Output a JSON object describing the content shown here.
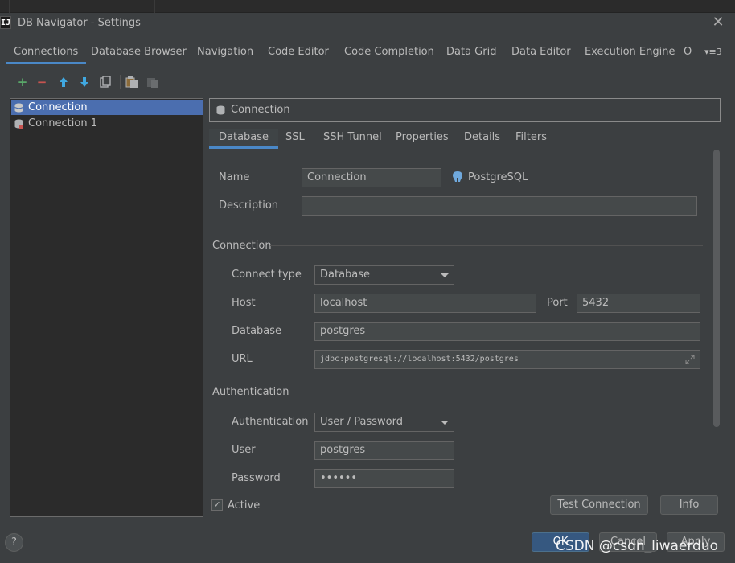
{
  "window": {
    "app_icon_text": "IJ",
    "title": "DB Navigator - Settings",
    "close_glyph": "✕"
  },
  "main_tabs": [
    {
      "label": "Connections",
      "active": true
    },
    {
      "label": "Database Browser",
      "active": false
    },
    {
      "label": "Navigation",
      "active": false
    },
    {
      "label": "Code Editor",
      "active": false
    },
    {
      "label": "Code Completion",
      "active": false
    },
    {
      "label": "Data Grid",
      "active": false
    },
    {
      "label": "Data Editor",
      "active": false
    },
    {
      "label": "Execution Engine",
      "active": false
    },
    {
      "label": "O",
      "active": false
    }
  ],
  "tabs_overflow": "▾≡3",
  "toolbar": {
    "add": "+",
    "remove": "−",
    "up": "🡅",
    "down": "🡇",
    "add_color": "#59a869",
    "remove_color": "#c75450",
    "move_color": "#40a8e0"
  },
  "connections": [
    {
      "label": "Connection",
      "selected": true,
      "icon": "database-icon"
    },
    {
      "label": "Connection 1",
      "selected": false,
      "icon": "database-error-icon"
    }
  ],
  "header": {
    "label": "Connection"
  },
  "sub_tabs": [
    {
      "label": "Database",
      "active": true
    },
    {
      "label": "SSL",
      "active": false
    },
    {
      "label": "SSH Tunnel",
      "active": false
    },
    {
      "label": "Properties",
      "active": false
    },
    {
      "label": "Details",
      "active": false
    },
    {
      "label": "Filters",
      "active": false
    }
  ],
  "form": {
    "name_label": "Name",
    "name_value": "Connection",
    "db_type": "PostgreSQL",
    "description_label": "Description",
    "description_value": "",
    "connection_section": "Connection",
    "connect_type_label": "Connect type",
    "connect_type_value": "Database",
    "host_label": "Host",
    "host_value": "localhost",
    "port_label": "Port",
    "port_value": "5432",
    "database_label": "Database",
    "database_value": "postgres",
    "url_label": "URL",
    "url_value": "jdbc:postgresql://localhost:5432/postgres",
    "auth_section": "Authentication",
    "authentication_label": "Authentication",
    "authentication_value": "User / Password",
    "user_label": "User",
    "user_value": "postgres",
    "password_label": "Password",
    "password_value": "••••••"
  },
  "active": {
    "label": "Active",
    "checked": true,
    "check_glyph": "✓"
  },
  "buttons": {
    "test_connection": "Test Connection",
    "info": "Info",
    "ok": "OK",
    "cancel": "Cancel",
    "apply": "Apply",
    "help": "?"
  },
  "watermark": "CSDN @csdn_liwaerduo",
  "colors": {
    "accent": "#4a88c7",
    "selection": "#4b6eaf",
    "primary_button": "#365880"
  }
}
